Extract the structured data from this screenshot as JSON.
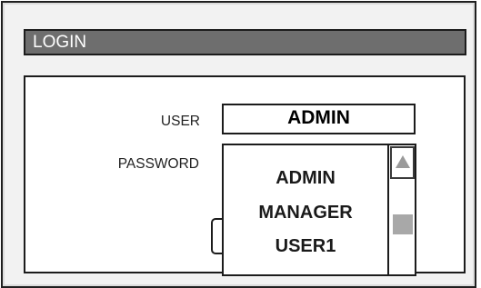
{
  "window": {
    "title": "LOGIN"
  },
  "form": {
    "user_label": "USER",
    "user_value": "ADMIN",
    "password_label": "PASSWORD"
  },
  "dropdown": {
    "options": [
      "ADMIN",
      "MANAGER",
      "USER1"
    ]
  },
  "icons": {
    "scroll_up": "triangle-up-icon"
  },
  "colors": {
    "title_bar": "#6e6e6e",
    "scroll_thumb": "#a8a8a8"
  }
}
